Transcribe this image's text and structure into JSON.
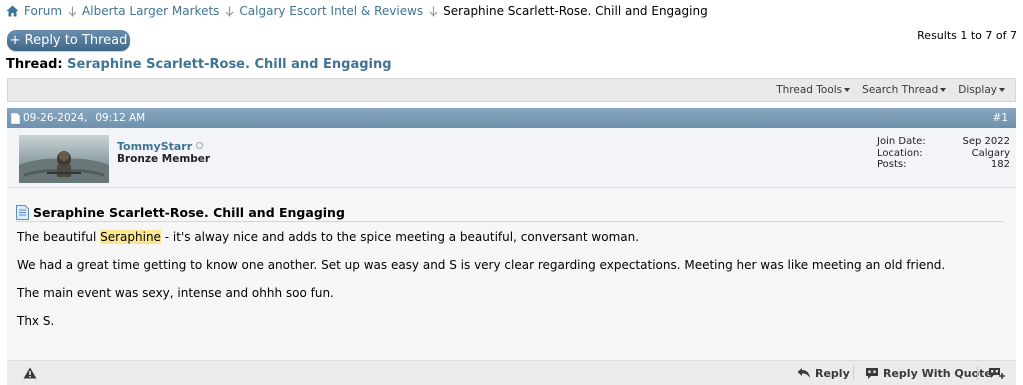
{
  "breadcrumb": {
    "items": [
      "Forum",
      "Alberta Larger Markets",
      "Calgary Escort Intel & Reviews"
    ],
    "current": "Seraphine Scarlett-Rose. Chill and Engaging"
  },
  "reply_button": "+ Reply to Thread",
  "results": "Results 1 to 7 of 7",
  "thread": {
    "prefix": "Thread:",
    "title": "Seraphine Scarlett-Rose. Chill and Engaging"
  },
  "toolbar": [
    "Thread Tools",
    "Search Thread",
    "Display"
  ],
  "post": {
    "date": "09-26-2024,",
    "time": "09:12 AM",
    "number": "#1",
    "user": {
      "name": "TommyStarr",
      "title": "Bronze Member",
      "stats": [
        {
          "label": "Join Date:",
          "value": "Sep 2022"
        },
        {
          "label": "Location:",
          "value": "Calgary"
        },
        {
          "label": "Posts:",
          "value": "182"
        }
      ]
    },
    "title": "Seraphine Scarlett-Rose. Chill and Engaging",
    "p1_start": "The beautiful ",
    "p1_highlight": "Seraphine",
    "p1_end": " - it's alway nice and adds to the spice meeting a beautiful, conversant woman.",
    "p2": "We had a great time getting to know one another. Set up was easy and S is very clear regarding expectations. Meeting her was like meeting an old friend.",
    "p3": "The main event was sexy, intense and ohhh soo fun.",
    "p4": "Thx S."
  },
  "footer": {
    "reply": "Reply",
    "reply_quote": "Reply With Quote"
  },
  "icons": {
    "home": "home-icon",
    "separator": "breadcrumb-separator-icon",
    "warning": "warning-icon",
    "reply": "reply-arrow-icon",
    "quote": "quote-icon",
    "multiquote": "multi-quote-icon"
  },
  "colors": {
    "link": "#417394",
    "header_bar": "#7896b0",
    "highlight": "#fbe78f"
  }
}
